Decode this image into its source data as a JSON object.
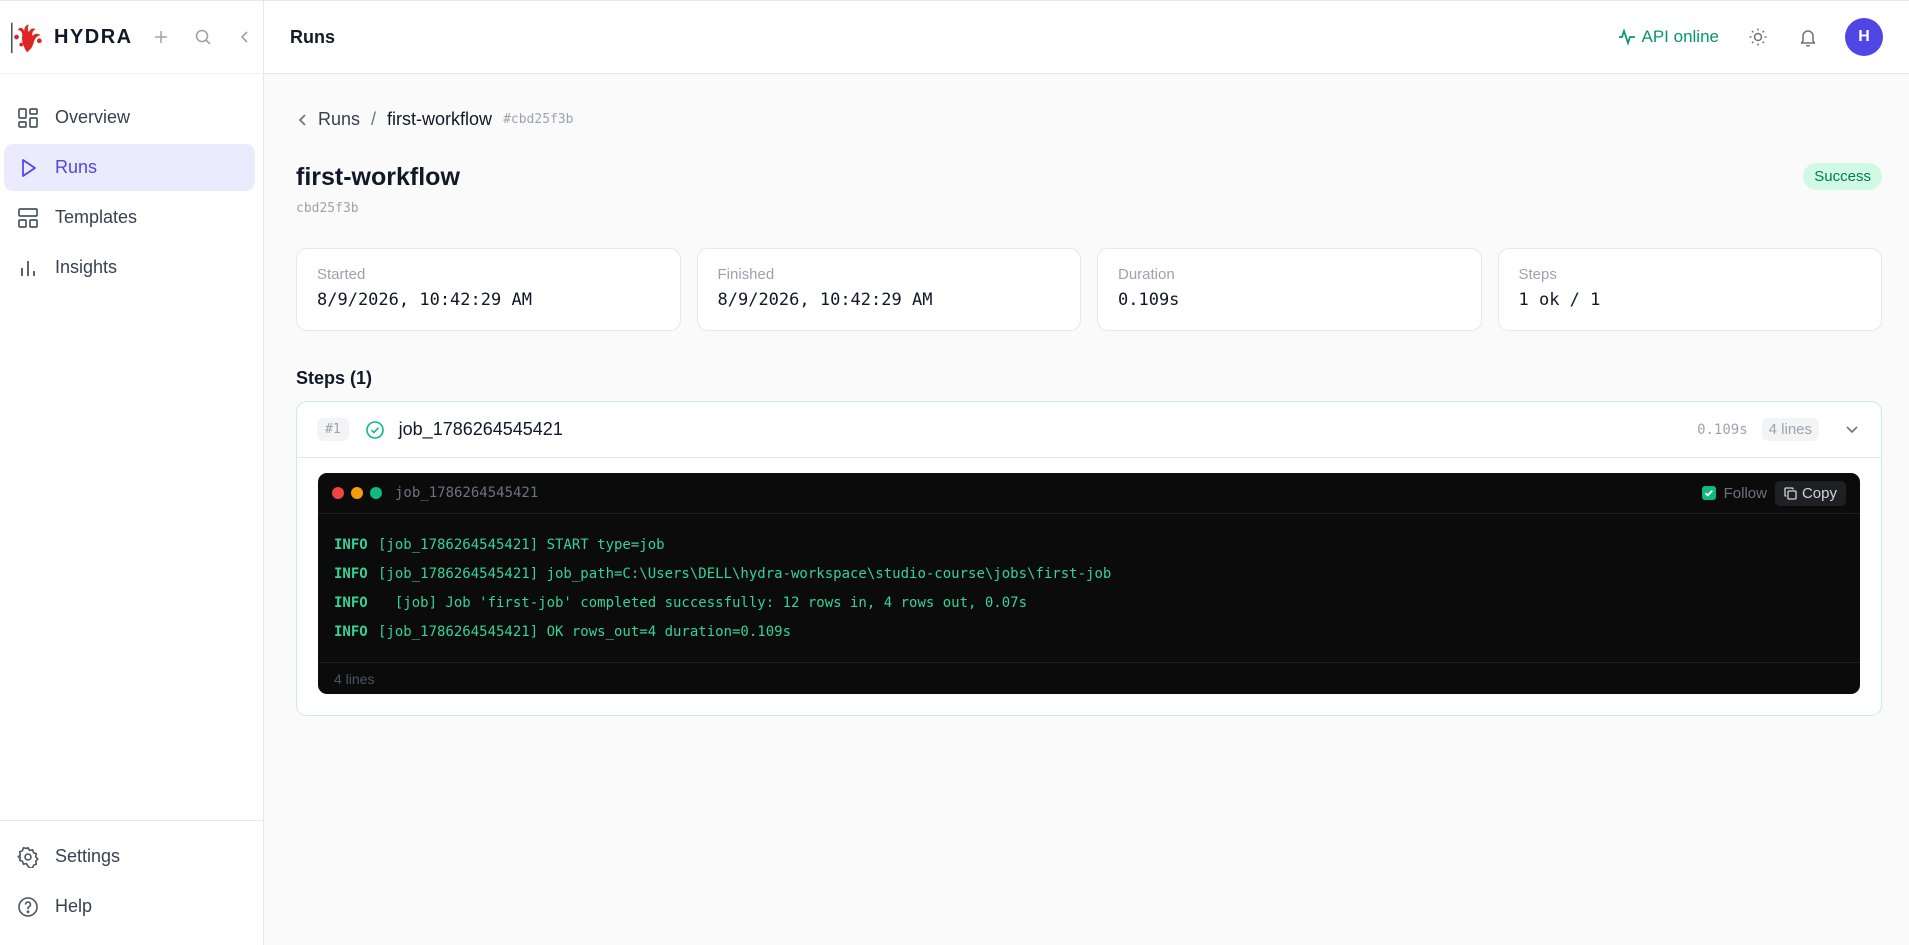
{
  "app": {
    "name": "HYDRA"
  },
  "sidebar": {
    "items": [
      {
        "label": "Overview",
        "icon": "overview-icon"
      },
      {
        "label": "Runs",
        "icon": "play-icon",
        "active": true
      },
      {
        "label": "Templates",
        "icon": "templates-icon"
      },
      {
        "label": "Insights",
        "icon": "chart-icon"
      }
    ],
    "bottom": [
      {
        "label": "Settings",
        "icon": "gear-icon"
      },
      {
        "label": "Help",
        "icon": "help-icon"
      }
    ]
  },
  "topbar": {
    "title": "Runs",
    "api_status": "API online",
    "avatar_initial": "H"
  },
  "breadcrumb": {
    "parent": "Runs",
    "current": "first-workflow",
    "hash": "#cbd25f3b"
  },
  "run": {
    "name": "first-workflow",
    "id": "cbd25f3b",
    "status": "Success"
  },
  "stats": [
    {
      "label": "Started",
      "value": "8/9/2026, 10:42:29 AM"
    },
    {
      "label": "Finished",
      "value": "8/9/2026, 10:42:29 AM"
    },
    {
      "label": "Duration",
      "value": "0.109s"
    },
    {
      "label": "Steps",
      "value": "1 ok / 1"
    }
  ],
  "steps": {
    "heading": "Steps (1)",
    "items": [
      {
        "num": "#1",
        "name": "job_1786264545421",
        "duration": "0.109s",
        "lines_badge": "4 lines",
        "terminal": {
          "title": "job_1786264545421",
          "follow_label": "Follow",
          "copy_label": "Copy",
          "footer": "4 lines",
          "lines": [
            {
              "level": "INFO",
              "text": "[job_1786264545421] START type=job"
            },
            {
              "level": "INFO",
              "text": "[job_1786264545421] job_path=C:\\Users\\DELL\\hydra-workspace\\studio-course\\jobs\\first-job"
            },
            {
              "level": "INFO",
              "text": "  [job] Job 'first-job' completed successfully: 12 rows in, 4 rows out, 0.07s"
            },
            {
              "level": "INFO",
              "text": "[job_1786264545421] OK rows_out=4 duration=0.109s"
            }
          ]
        }
      }
    ]
  },
  "colors": {
    "accent": "#4f46e5",
    "success": "#10b981",
    "terminal_bg": "#0b0b0c"
  }
}
